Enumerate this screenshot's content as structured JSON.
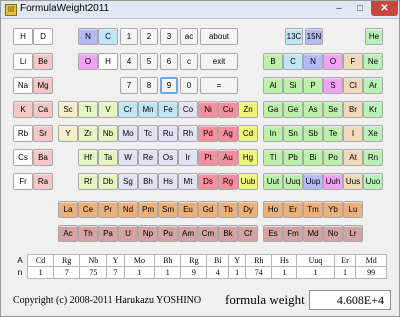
{
  "window": {
    "title": "FormulaWeight2011",
    "icon_name": "app-icon",
    "caption_minimize": "–",
    "caption_maximize": "□",
    "caption_close": "✕"
  },
  "colors": {
    "alkali": "#f6c7c7",
    "alkaline_earth": "#f5ecc9",
    "metal": "#bfe5f7",
    "transition_3d": "#e4f5c4",
    "transition_4d5d": "#e2e2f6",
    "red_group": "#fb8e9c",
    "yellow_group": "#eef57a",
    "lanthanide": "#ecb07b",
    "actinide": "#d4a3a3",
    "nonmetal": "#bdf1ab",
    "halogen": "#f0d8ba",
    "noble": "#b9f2b9",
    "keypad": "#f4f4f4",
    "isotope": "#b4b9f7"
  },
  "rows": [
    [
      {
        "label": "H",
        "color": "#ffffff"
      },
      {
        "label": "D",
        "color": "#ffffff"
      },
      {
        "label": "N",
        "color": "#b4b9f7"
      },
      {
        "label": "C",
        "color": "#bfe5f7"
      },
      {
        "label": "1",
        "color": "#f4f4f4"
      },
      {
        "label": "2",
        "color": "#f4f4f4"
      },
      {
        "label": "3",
        "color": "#f4f4f4"
      },
      {
        "label": "ac",
        "color": "#f4f4f4"
      },
      {
        "label": "about",
        "color": "#f4f4f4",
        "wide": true
      },
      {
        "label": "13C",
        "color": "#bfe5f7"
      },
      {
        "label": "15N",
        "color": "#b4b9f7"
      },
      {
        "label": "He",
        "color": "#b9f2b9"
      }
    ],
    [
      {
        "label": "Li",
        "color": "#ffffff"
      },
      {
        "label": "Be",
        "color": "#f6c7c7"
      },
      {
        "label": "O",
        "color": "#f3a3f5"
      },
      {
        "label": "H",
        "color": "#ffffff"
      },
      {
        "label": "4",
        "color": "#f4f4f4"
      },
      {
        "label": "5",
        "color": "#f4f4f4"
      },
      {
        "label": "6",
        "color": "#f4f4f4"
      },
      {
        "label": "c",
        "color": "#f4f4f4"
      },
      {
        "label": "exit",
        "color": "#f4f4f4",
        "wide": true
      },
      {
        "label": "B",
        "color": "#bdf1ab"
      },
      {
        "label": "C",
        "color": "#bfe5f7"
      },
      {
        "label": "N",
        "color": "#b4b9f7"
      },
      {
        "label": "O",
        "color": "#f3a3f5"
      },
      {
        "label": "F",
        "color": "#f0d8ba"
      },
      {
        "label": "Ne",
        "color": "#b9f2b9"
      }
    ],
    [
      {
        "label": "Na",
        "color": "#ffffff"
      },
      {
        "label": "Mg",
        "color": "#f6c7c7"
      },
      {
        "label": "7",
        "color": "#f4f4f4"
      },
      {
        "label": "8",
        "color": "#f4f4f4"
      },
      {
        "label": "9",
        "color": "#f4f4f4",
        "selected": true
      },
      {
        "label": "0",
        "color": "#f4f4f4"
      },
      {
        "label": "=",
        "color": "#f4f4f4",
        "wide": true
      },
      {
        "label": "Al",
        "color": "#bdf1ab"
      },
      {
        "label": "Si",
        "color": "#bdf1ab"
      },
      {
        "label": "P",
        "color": "#bdf1ab"
      },
      {
        "label": "S",
        "color": "#f3a3f5"
      },
      {
        "label": "Cl",
        "color": "#f0d8ba"
      },
      {
        "label": "Ar",
        "color": "#b9f2b9"
      }
    ],
    [
      {
        "label": "K",
        "color": "#f6c7c7"
      },
      {
        "label": "Ca",
        "color": "#f6c7c7"
      },
      {
        "label": "Sc",
        "color": "#f5ecc9"
      },
      {
        "label": "Ti",
        "color": "#e4f5c4"
      },
      {
        "label": "V",
        "color": "#e4f5c4"
      },
      {
        "label": "Cr",
        "color": "#bfe5f7"
      },
      {
        "label": "Mn",
        "color": "#bfe5f7"
      },
      {
        "label": "Fe",
        "color": "#bfe5f7"
      },
      {
        "label": "Co",
        "color": "#e2e2f6"
      },
      {
        "label": "Ni",
        "color": "#fb8e9c"
      },
      {
        "label": "Cu",
        "color": "#fb8e9c"
      },
      {
        "label": "Zn",
        "color": "#eef57a"
      },
      {
        "label": "Ga",
        "color": "#bdf1ab"
      },
      {
        "label": "Ge",
        "color": "#bdf1ab"
      },
      {
        "label": "As",
        "color": "#bdf1ab"
      },
      {
        "label": "Se",
        "color": "#bdf1ab"
      },
      {
        "label": "Br",
        "color": "#f0d8ba"
      },
      {
        "label": "Kr",
        "color": "#b9f2b9"
      }
    ],
    [
      {
        "label": "Rb",
        "color": "#ffffff"
      },
      {
        "label": "Sr",
        "color": "#f6c7c7"
      },
      {
        "label": "Y",
        "color": "#f5ecc9"
      },
      {
        "label": "Zr",
        "color": "#e4f5c4"
      },
      {
        "label": "Nb",
        "color": "#e4f5c4"
      },
      {
        "label": "Mo",
        "color": "#e2e2f6"
      },
      {
        "label": "Tc",
        "color": "#e2e2f6"
      },
      {
        "label": "Ru",
        "color": "#e2e2f6"
      },
      {
        "label": "Rh",
        "color": "#e2e2f6"
      },
      {
        "label": "Pd",
        "color": "#fb8e9c"
      },
      {
        "label": "Ag",
        "color": "#fb8e9c"
      },
      {
        "label": "Cd",
        "color": "#eef57a"
      },
      {
        "label": "In",
        "color": "#bdf1ab"
      },
      {
        "label": "Sn",
        "color": "#bdf1ab"
      },
      {
        "label": "Sb",
        "color": "#bdf1ab"
      },
      {
        "label": "Te",
        "color": "#bdf1ab"
      },
      {
        "label": "I",
        "color": "#f0d8ba"
      },
      {
        "label": "Xe",
        "color": "#b9f2b9"
      }
    ],
    [
      {
        "label": "Cs",
        "color": "#ffffff"
      },
      {
        "label": "Ba",
        "color": "#f6c7c7"
      },
      {
        "label": "Hf",
        "color": "#e4f5c4"
      },
      {
        "label": "Ta",
        "color": "#e4f5c4"
      },
      {
        "label": "W",
        "color": "#e2e2f6"
      },
      {
        "label": "Re",
        "color": "#e2e2f6"
      },
      {
        "label": "Os",
        "color": "#e2e2f6"
      },
      {
        "label": "Ir",
        "color": "#e2e2f6"
      },
      {
        "label": "Pt",
        "color": "#fb8e9c"
      },
      {
        "label": "Au",
        "color": "#fb8e9c"
      },
      {
        "label": "Hg",
        "color": "#eef57a"
      },
      {
        "label": "Tl",
        "color": "#bdf1ab"
      },
      {
        "label": "Pb",
        "color": "#bdf1ab"
      },
      {
        "label": "Bi",
        "color": "#bdf1ab"
      },
      {
        "label": "Po",
        "color": "#bdf1ab"
      },
      {
        "label": "At",
        "color": "#f0d8ba"
      },
      {
        "label": "Rn",
        "color": "#b9f2b9"
      }
    ],
    [
      {
        "label": "Fr",
        "color": "#ffffff"
      },
      {
        "label": "Ra",
        "color": "#f6c7c7"
      },
      {
        "label": "Rf",
        "color": "#e4f5c4"
      },
      {
        "label": "Db",
        "color": "#e4f5c4"
      },
      {
        "label": "Sg",
        "color": "#e2e2f6"
      },
      {
        "label": "Bh",
        "color": "#e2e2f6"
      },
      {
        "label": "Hs",
        "color": "#e2e2f6"
      },
      {
        "label": "Mt",
        "color": "#e2e2f6"
      },
      {
        "label": "Ds",
        "color": "#fb8e9c"
      },
      {
        "label": "Rg",
        "color": "#fb8e9c"
      },
      {
        "label": "Uub",
        "color": "#eef57a"
      },
      {
        "label": "Uut",
        "color": "#bdf1ab"
      },
      {
        "label": "Uuq",
        "color": "#bdf1ab"
      },
      {
        "label": "Uup",
        "color": "#b4b9f7"
      },
      {
        "label": "Uuh",
        "color": "#f3a3f5"
      },
      {
        "label": "Uus",
        "color": "#f0d8ba"
      },
      {
        "label": "Uuo",
        "color": "#b9f2b9"
      }
    ],
    [
      {
        "label": "La",
        "color": "#ecb07b"
      },
      {
        "label": "Ce",
        "color": "#ecb07b"
      },
      {
        "label": "Pr",
        "color": "#ecb07b"
      },
      {
        "label": "Nd",
        "color": "#ecb07b"
      },
      {
        "label": "Pm",
        "color": "#ecb07b"
      },
      {
        "label": "Sm",
        "color": "#ecb07b"
      },
      {
        "label": "Eu",
        "color": "#ecb07b"
      },
      {
        "label": "Gd",
        "color": "#ecb07b"
      },
      {
        "label": "Tb",
        "color": "#ecb07b"
      },
      {
        "label": "Dy",
        "color": "#ecb07b"
      },
      {
        "label": "Ho",
        "color": "#ecb07b"
      },
      {
        "label": "Er",
        "color": "#ecb07b"
      },
      {
        "label": "Tm",
        "color": "#ecb07b"
      },
      {
        "label": "Yb",
        "color": "#ecb07b"
      },
      {
        "label": "Lu",
        "color": "#ecb07b"
      }
    ],
    [
      {
        "label": "Ac",
        "color": "#d4a3a3"
      },
      {
        "label": "Th",
        "color": "#d4a3a3"
      },
      {
        "label": "Pa",
        "color": "#d4a3a3"
      },
      {
        "label": "U",
        "color": "#d4a3a3"
      },
      {
        "label": "Np",
        "color": "#d4a3a3"
      },
      {
        "label": "Pu",
        "color": "#d4a3a3"
      },
      {
        "label": "Am",
        "color": "#d4a3a3"
      },
      {
        "label": "Cm",
        "color": "#d4a3a3"
      },
      {
        "label": "Bk",
        "color": "#d4a3a3"
      },
      {
        "label": "Cf",
        "color": "#d4a3a3"
      },
      {
        "label": "Es",
        "color": "#d4a3a3"
      },
      {
        "label": "Fm",
        "color": "#d4a3a3"
      },
      {
        "label": "Md",
        "color": "#d4a3a3"
      },
      {
        "label": "No",
        "color": "#d4a3a3"
      },
      {
        "label": "Lr",
        "color": "#d4a3a3"
      }
    ]
  ],
  "composition": {
    "row_label_a": "A",
    "row_label_n": "n",
    "elements": [
      "Cd",
      "Rg",
      "Nb",
      "Y",
      "Mo",
      "Bh",
      "Rg",
      "Bi",
      "Y",
      "Rh",
      "Hs",
      "Uuq",
      "Er",
      "Md"
    ],
    "counts": [
      "1",
      "7",
      "75",
      "7",
      "1",
      "1",
      "9",
      "4",
      "1",
      "74",
      "1",
      "1",
      "1",
      "99"
    ]
  },
  "footer": {
    "copyright": "Copyright (c) 2008-2011 Harukazu YOSHINO",
    "weight_label": "formula weight",
    "weight_value": "4.608E+4"
  }
}
